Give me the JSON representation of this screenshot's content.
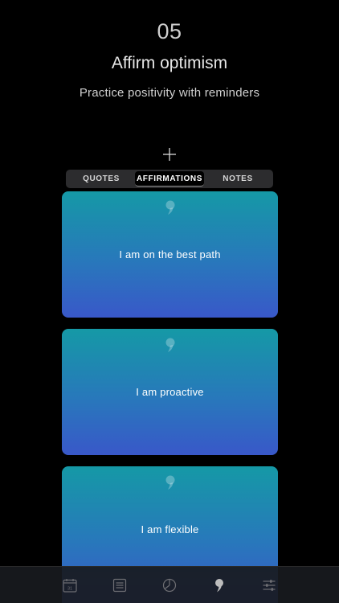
{
  "header": {
    "step_number": "05",
    "title": "Affirm optimism",
    "subtitle": "Practice positivity with reminders"
  },
  "add_button": {
    "icon": "plus-icon"
  },
  "tabs": [
    {
      "label": "QUOTES",
      "selected": false
    },
    {
      "label": "AFFIRMATIONS",
      "selected": true
    },
    {
      "label": "NOTES",
      "selected": false
    }
  ],
  "cards": [
    {
      "text": "I am on the best path",
      "icon": "quote-mark-icon"
    },
    {
      "text": "I am proactive",
      "icon": "quote-mark-icon"
    },
    {
      "text": "I am flexible",
      "icon": "quote-mark-icon"
    }
  ],
  "tabbar": {
    "items": [
      {
        "icon": "calendar-icon",
        "calendar_day": "31",
        "active": false
      },
      {
        "icon": "list-icon",
        "active": false
      },
      {
        "icon": "pie-chart-icon",
        "active": false
      },
      {
        "icon": "quote-icon",
        "active": true
      },
      {
        "icon": "sliders-icon",
        "active": false
      }
    ]
  },
  "colors": {
    "background": "#000000",
    "card_gradient_top": "#1599a6",
    "card_gradient_bottom": "#3958c9",
    "tab_background": "#2c2c2e",
    "tabbar_icon": "#6e6e73",
    "tabbar_icon_active": "#bdbdbd"
  }
}
